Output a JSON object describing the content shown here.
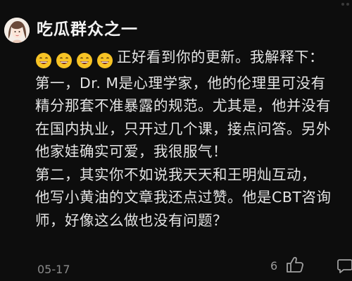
{
  "comment": {
    "username": "吃瓜群众之一",
    "avatar_icon": "avatar-girl-illustration",
    "emoji_icon": "grinning-face-emoji",
    "emoji_count": 4,
    "lines": [
      "正好看到你的更新。我解释下：",
      "第一，Dr. M是心理学家，他的伦理里可没有",
      "精分那套不准暴露的规范。尤其是，他并没有",
      "在国内执业，只开过几个课，接点问答。另外",
      "他家娃确实可爱，我很服气！",
      "第二，其实你不如说我天天和王明灿互动，",
      "他写小黄油的文章我还点过赞。他是CBT咨询",
      "师，好像这么做也没有问题？"
    ],
    "date": "05-17",
    "like_count": "6",
    "like_icon": "thumbs-up-icon",
    "reply_icon": "comment-icon"
  }
}
